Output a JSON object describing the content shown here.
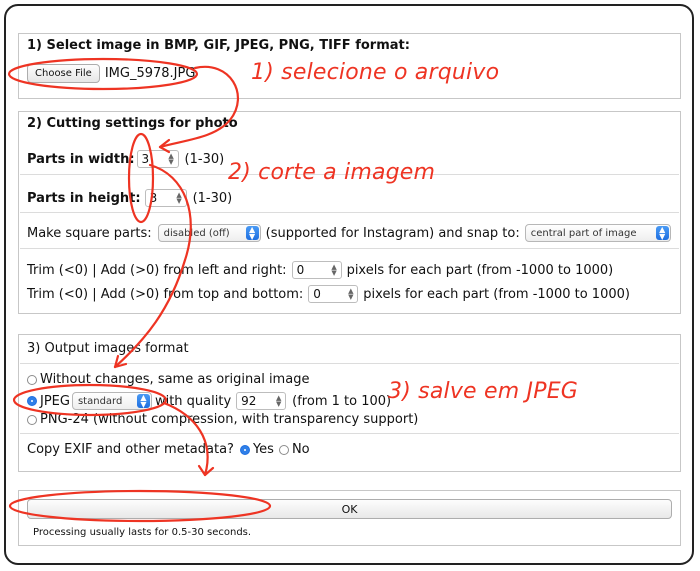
{
  "section1": {
    "title": "1) Select image in BMP, GIF, JPEG, PNG, TIFF format:",
    "choose_file_label": "Choose File",
    "file_name": "IMG_5978.JPG"
  },
  "section2": {
    "title": "2) Cutting settings for photo",
    "width_label": "Parts in width:",
    "width_value": "3",
    "width_range": "(1-30)",
    "height_label": "Parts in height:",
    "height_value": "3",
    "height_range": "(1-30)",
    "square_label": "Make square parts:",
    "square_select": "disabled (off)",
    "square_note": "(supported for Instagram) and snap to:",
    "snap_select": "central part of image",
    "trim_lr_label": "Trim (<0) | Add (>0) from left and right:",
    "trim_lr_value": "0",
    "trim_lr_suffix": "pixels for each part (from -1000 to 1000)",
    "trim_tb_label": "Trim (<0) | Add (>0) from top and bottom:",
    "trim_tb_value": "0",
    "trim_tb_suffix": "pixels for each part (from -1000 to 1000)"
  },
  "section3": {
    "title": "3) Output images format",
    "opt_original": "Without changes, same as original image",
    "opt_jpeg": "JPEG",
    "jpeg_select": "standard",
    "quality_label": "with quality",
    "quality_value": "92",
    "quality_range": "(from 1 to 100)",
    "opt_png": "PNG-24 (without compression, with transparency support)",
    "exif_label": "Copy EXIF and other metadata?",
    "exif_yes": "Yes",
    "exif_no": "No"
  },
  "submit": {
    "ok_label": "OK",
    "note": "Processing usually lasts for 0.5-30 seconds."
  },
  "annotations": {
    "step1": "1) selecione o arquivo",
    "step2": "2) corte a imagem",
    "step3": "3) salve em JPEG",
    "color": "#ee3423"
  }
}
